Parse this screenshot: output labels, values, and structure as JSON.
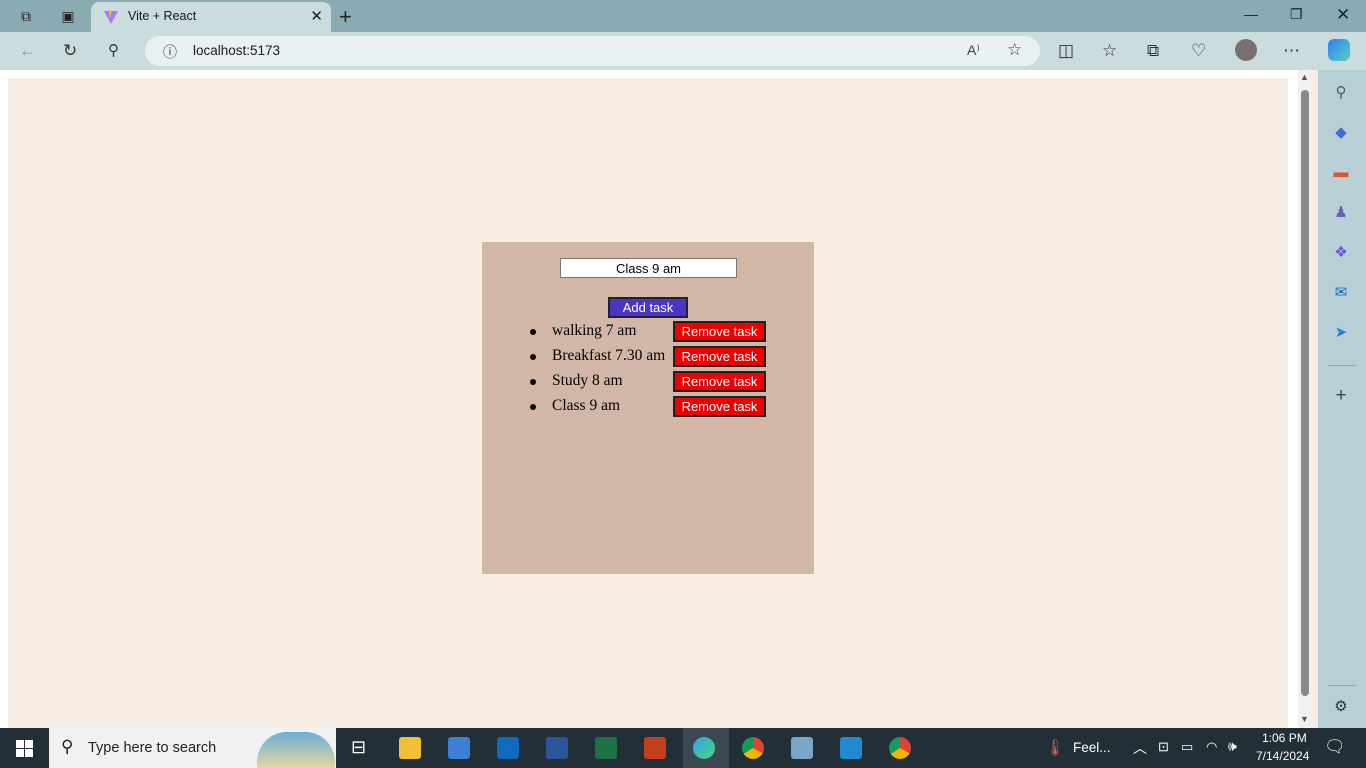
{
  "browser": {
    "tab_title": "Vite + React",
    "url": "localhost:5173"
  },
  "app": {
    "input_value": "Class 9 am",
    "add_label": "Add task",
    "tasks": [
      {
        "text": "walking 7 am",
        "remove_label": "Remove task"
      },
      {
        "text": "Breakfast 7.30 am",
        "remove_label": "Remove task"
      },
      {
        "text": "Study 8 am",
        "remove_label": "Remove task"
      },
      {
        "text": "Class 9 am",
        "remove_label": "Remove task"
      }
    ]
  },
  "taskbar": {
    "search_placeholder": "Type here to search",
    "weather": "Feel...",
    "time": "1:06 PM",
    "date": "7/14/2024"
  },
  "colors": {
    "page_bg": "#f7ede3",
    "card_bg": "#d2b7a8",
    "add_button": "#4a36c2",
    "remove_button": "#ee0000"
  }
}
